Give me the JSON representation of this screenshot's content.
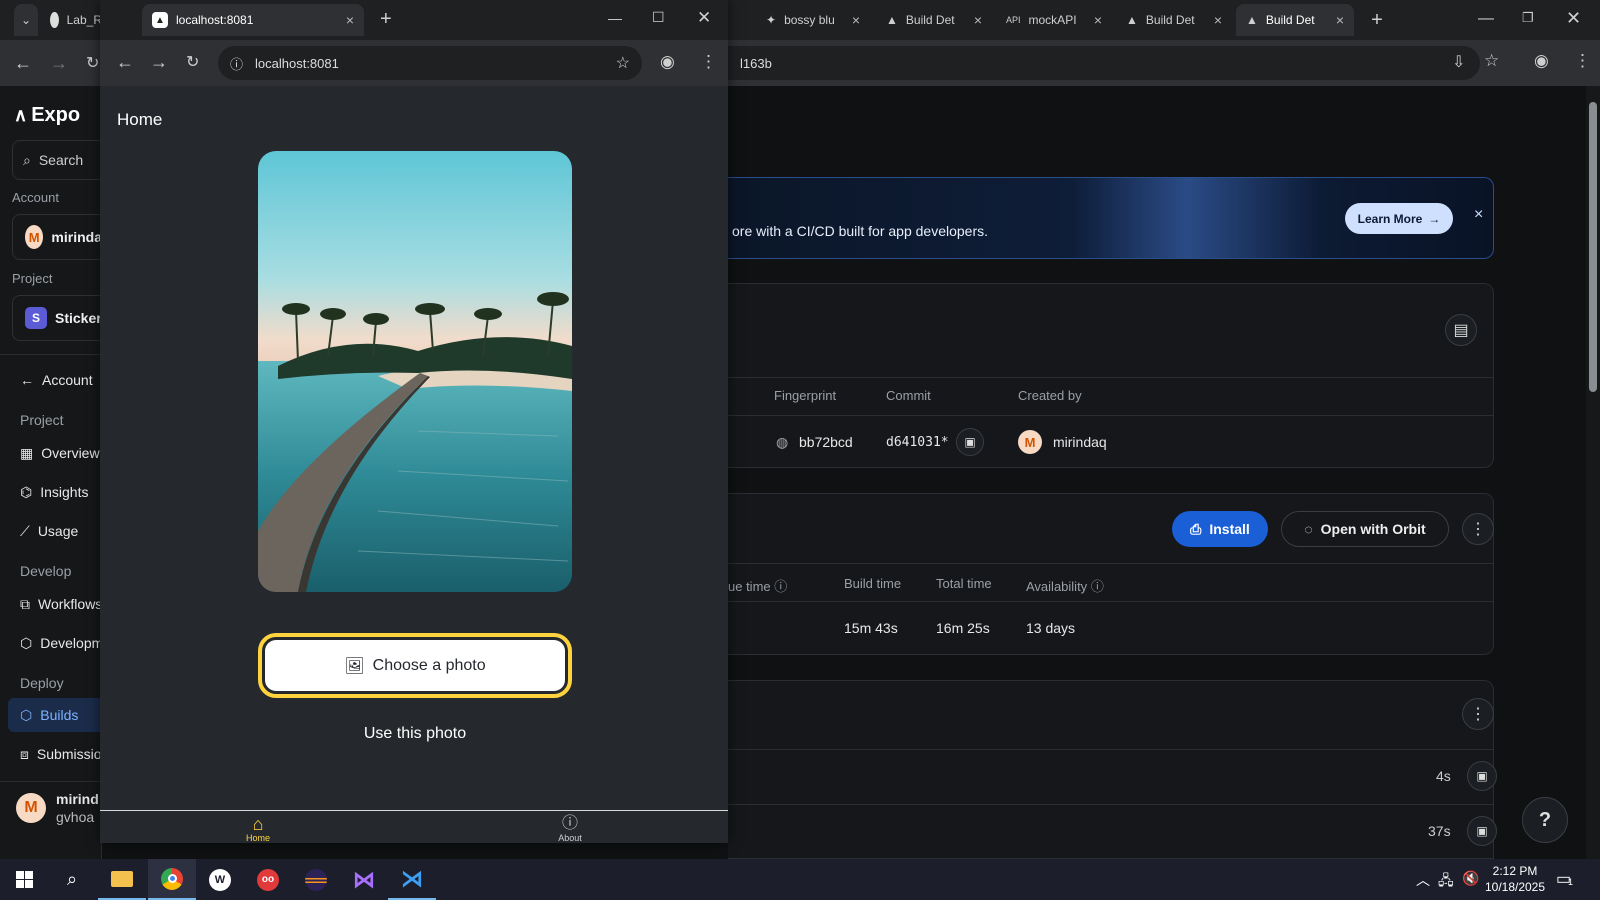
{
  "tabs": {
    "bg_tabs": [
      {
        "label": "Lab_R"
      },
      {
        "label": "bossy blu"
      },
      {
        "label": "Build Det"
      },
      {
        "label": "mockAPI"
      },
      {
        "label": "Build Det"
      },
      {
        "label": "Build Det"
      }
    ],
    "popup_tab": {
      "label": "localhost:8081"
    }
  },
  "bg_address": {
    "text": "l163b"
  },
  "popup_address": {
    "text": "localhost:8081"
  },
  "sidebar": {
    "logo": "Expo",
    "search_label": "Search",
    "account_label": "Account",
    "account_name": "mirinda",
    "account_initial": "M",
    "project_label": "Project",
    "project_name": "Sticker",
    "project_initial": "S",
    "back_item": "Account",
    "section_project": "Project",
    "items_project": [
      "Overview",
      "Insights",
      "Usage"
    ],
    "section_develop": "Develop",
    "items_develop": [
      "Workflows",
      "Development"
    ],
    "section_deploy": "Deploy",
    "items_deploy": [
      "Builds",
      "Submissions"
    ],
    "footer_name": "mirind",
    "footer_sub": "gvhoa",
    "footer_initial": "M"
  },
  "banner": {
    "text": "ore with a CI/CD built for app developers.",
    "learn_more": "Learn More",
    "close": "×"
  },
  "details": {
    "headers": {
      "fingerprint": "Fingerprint",
      "commit": "Commit",
      "created_by": "Created by"
    },
    "fingerprint": "bb72bcd",
    "commit": "d641031*",
    "created_by": "mirindaq",
    "created_initial": "M"
  },
  "build": {
    "install": "Install",
    "open_orbit": "Open with Orbit",
    "headers": {
      "queue": "ue time",
      "build_time": "Build time",
      "total_time": "Total time",
      "availability": "Availability"
    },
    "build_time": "15m 43s",
    "total_time": "16m 25s",
    "availability": "13 days"
  },
  "logs": {
    "row1": "4s",
    "row2": "37s",
    "help": "?"
  },
  "app": {
    "title": "Home",
    "choose_photo": "Choose a photo",
    "use_photo": "Use this photo",
    "nav_home": "Home",
    "nav_about": "About"
  },
  "taskbar": {
    "time": "2:12 PM",
    "date": "10/18/2025",
    "notif_count": "1"
  },
  "colors": {
    "accent_blue": "#1a5fd6",
    "highlight_yellow": "#ffd33d",
    "home_active": "#ffd33d"
  }
}
